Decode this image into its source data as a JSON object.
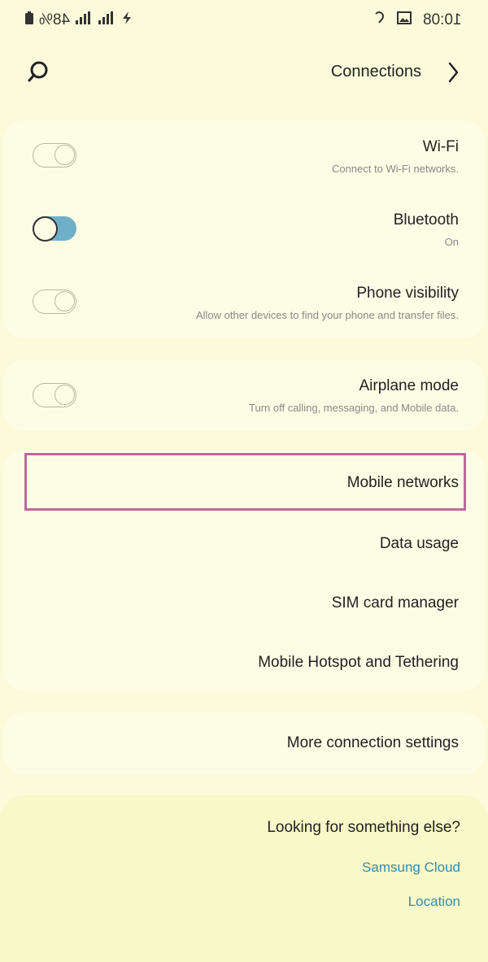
{
  "status": {
    "time": "10:08",
    "battery": "48%",
    "icons": [
      "battery-icon",
      "signal-icon",
      "signal-icon",
      "charging-icon",
      "image-icon",
      "hotspot-icon"
    ]
  },
  "header": {
    "title": "Connections",
    "back_icon": "chevron-back-icon",
    "search_icon": "search-icon"
  },
  "toggles": [
    {
      "title": "Wi-Fi",
      "subtitle": "Connect to Wi-Fi networks.",
      "state": "off"
    },
    {
      "title": "Bluetooth",
      "subtitle": "On",
      "state": "on"
    },
    {
      "title": "Phone visibility",
      "subtitle": "Allow other devices to find your phone and transfer files.",
      "state": "off"
    },
    {
      "title": "Airplane mode",
      "subtitle": "Turn off calling, messaging, and Mobile data.",
      "state": "off"
    }
  ],
  "menu": {
    "mobile_networks": "Mobile networks",
    "data_usage": "Data usage",
    "sim_manager": "SIM card manager",
    "hotspot": "Mobile Hotspot and Tethering",
    "more_settings": "More connection settings"
  },
  "suggestions": {
    "heading": "Looking for something else?",
    "links": [
      "Samsung Cloud",
      "Location"
    ]
  },
  "colors": {
    "background": "#fbfbdc",
    "toggle_on": "#6fb0c9",
    "link": "#3a8aa8",
    "highlight": "#c0689a"
  }
}
